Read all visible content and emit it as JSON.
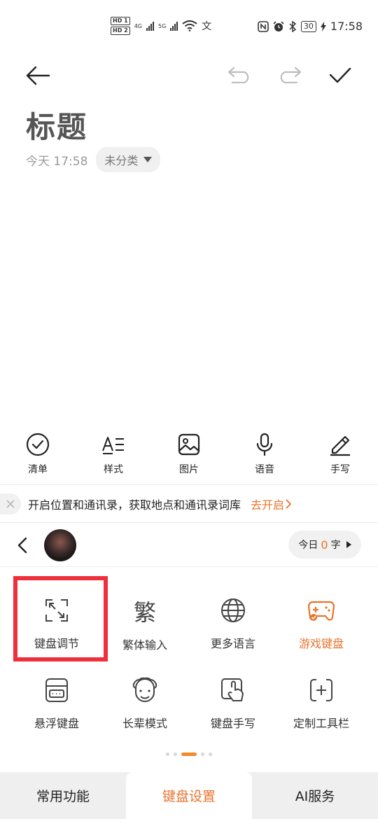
{
  "status_bar": {
    "hd1": "HD 1",
    "hd2": "HD 2",
    "net1": "4G",
    "net2": "5G",
    "battery": "30",
    "time": "17:58",
    "icons": [
      "nfc-icon",
      "alarm-icon",
      "bluetooth-icon",
      "charging-icon"
    ]
  },
  "header": {
    "back_icon": "back-arrow-icon",
    "undo_icon": "undo-icon",
    "redo_icon": "redo-icon",
    "confirm_icon": "check-icon"
  },
  "note": {
    "title": "标题",
    "date": "今天 17:58",
    "category": "未分类"
  },
  "editor_toolbar": [
    {
      "label": "清单",
      "icon": "checklist-icon"
    },
    {
      "label": "样式",
      "icon": "text-style-icon"
    },
    {
      "label": "图片",
      "icon": "image-icon"
    },
    {
      "label": "语音",
      "icon": "microphone-icon"
    },
    {
      "label": "手写",
      "icon": "pen-icon"
    }
  ],
  "banner": {
    "text": "开启位置和通讯录，获取地点和通讯录词库",
    "link": "去开启"
  },
  "keyboard_header": {
    "today_label": "今日",
    "count": "0",
    "unit": "字"
  },
  "keyboard_grid": [
    {
      "label": "键盘调节",
      "icon": "resize-icon"
    },
    {
      "label": "繁体输入",
      "icon": "traditional-char-icon",
      "glyph": "繁"
    },
    {
      "label": "更多语言",
      "icon": "globe-icon"
    },
    {
      "label": "游戏键盘",
      "icon": "gamepad-icon"
    },
    {
      "label": "悬浮键盘",
      "icon": "floating-keyboard-icon"
    },
    {
      "label": "长辈模式",
      "icon": "elder-face-icon"
    },
    {
      "label": "键盘手写",
      "icon": "handwriting-icon"
    },
    {
      "label": "定制工具栏",
      "icon": "custom-toolbar-icon"
    }
  ],
  "page_indicator": {
    "count": 5,
    "active": 2
  },
  "bottom_tabs": [
    {
      "label": "常用功能"
    },
    {
      "label": "键盘设置"
    },
    {
      "label": "AI服务"
    }
  ],
  "colors": {
    "accent": "#e8742d",
    "highlight": "#ee2f3c",
    "text": "#222222",
    "muted": "#9a9a9a"
  }
}
